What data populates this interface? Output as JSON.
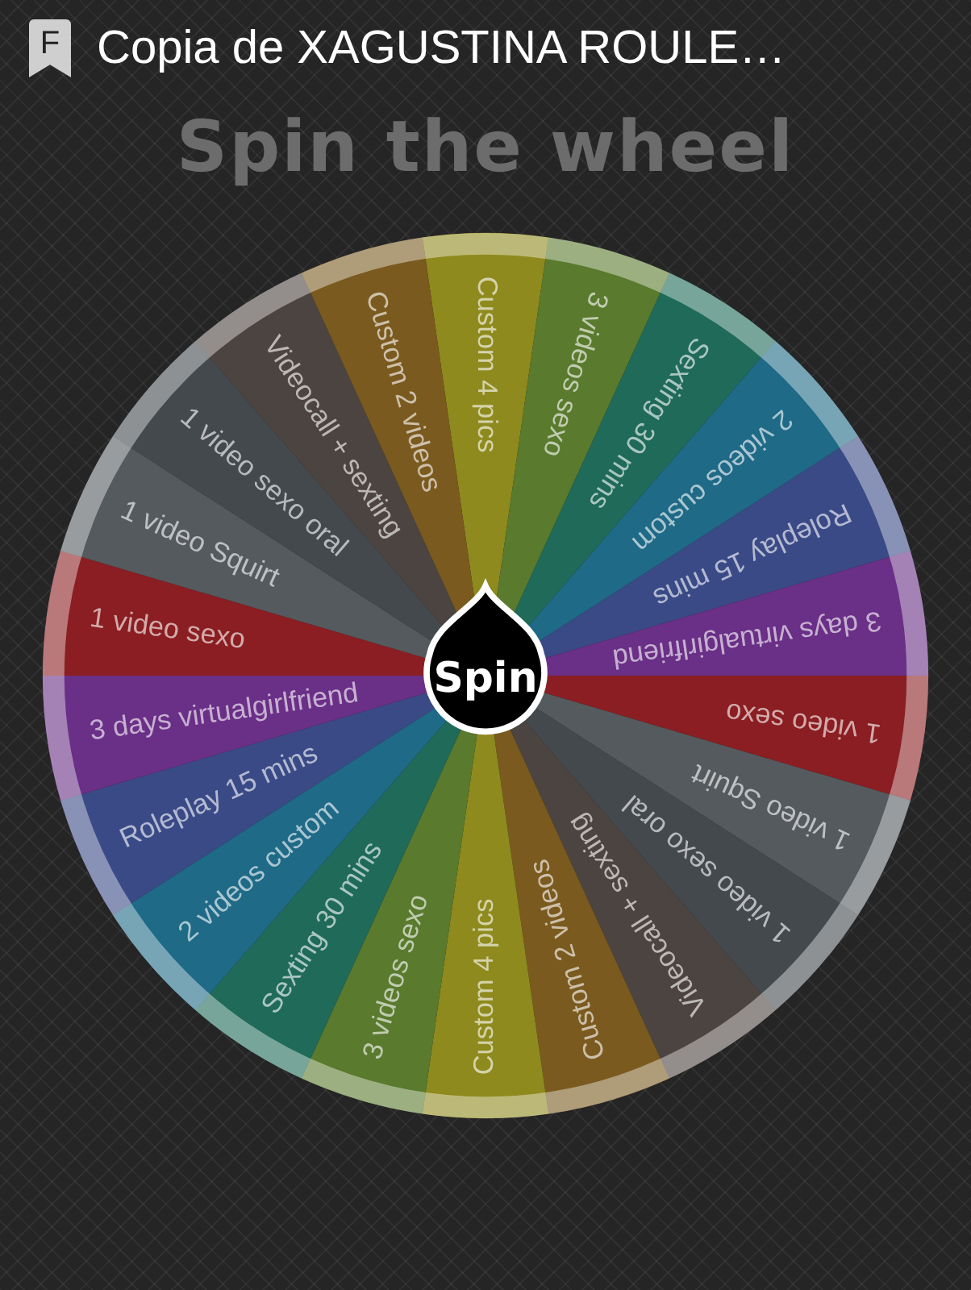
{
  "header": {
    "app_icon_letter": "F",
    "title": "Copia de XAGUSTINA ROULE…"
  },
  "heading": "Spin the wheel",
  "wheel": {
    "spin_button": "Spin",
    "segments": [
      {
        "label": "Custom 4 pics",
        "color": "#8f8a1e"
      },
      {
        "label": "3 videos sexo",
        "color": "#5a7a2e"
      },
      {
        "label": "Sexting 30 mins",
        "color": "#1f6a58"
      },
      {
        "label": "2 videos custom",
        "color": "#1f6a86"
      },
      {
        "label": "Roleplay 15 mins",
        "color": "#3a4a86"
      },
      {
        "label": "3 days virtualgirlfriend",
        "color": "#6a2f86"
      },
      {
        "label": "1 video sexo",
        "color": "#8a1e22"
      },
      {
        "label": "1 video Squirt",
        "color": "#555a5e"
      },
      {
        "label": "1 video sexo oral",
        "color": "#44494e"
      },
      {
        "label": "Videocall + sexting",
        "color": "#4c4440"
      },
      {
        "label": "Custom 2 videos",
        "color": "#7a5a1e"
      },
      {
        "label": "Custom 4 pics",
        "color": "#8f8a1e"
      },
      {
        "label": "3 videos sexo",
        "color": "#5a7a2e"
      },
      {
        "label": "Sexting 30 mins",
        "color": "#1f6a58"
      },
      {
        "label": "2 videos custom",
        "color": "#1f6a86"
      },
      {
        "label": "Roleplay 15 mins",
        "color": "#3a4a86"
      },
      {
        "label": "3 days virtualgirlfriend",
        "color": "#6a2f86"
      },
      {
        "label": "1 video sexo",
        "color": "#8a1e22"
      },
      {
        "label": "1 video Squirt",
        "color": "#555a5e"
      },
      {
        "label": "1 video sexo oral",
        "color": "#44494e"
      },
      {
        "label": "Videocall + sexting",
        "color": "#4c4440"
      },
      {
        "label": "Custom 2 videos",
        "color": "#7a5a1e"
      }
    ]
  }
}
